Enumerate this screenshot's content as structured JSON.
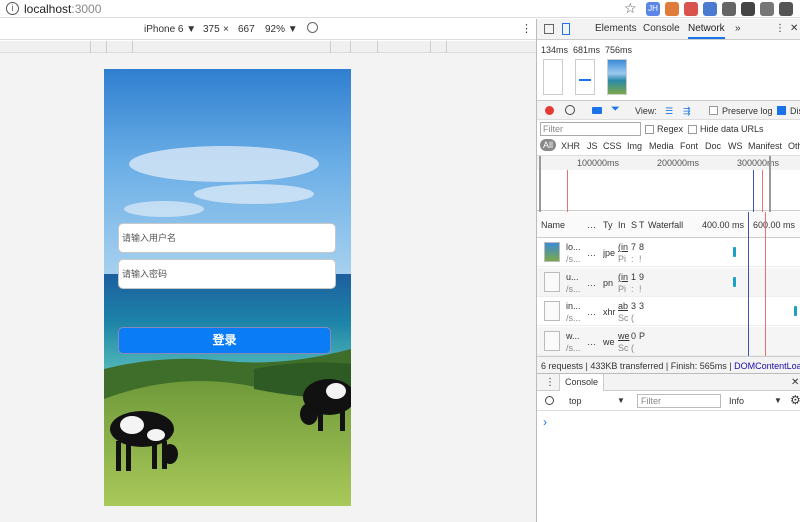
{
  "browser": {
    "url_host": "localhost",
    "url_port": ":3000",
    "extensions": [
      {
        "label": "JH",
        "color": "#5b86e5"
      },
      {
        "label": "",
        "color": "#e07b39"
      },
      {
        "label": "",
        "color": "#d9534f"
      },
      {
        "label": "",
        "color": "#4a7bd0"
      },
      {
        "label": "",
        "color": "#666666"
      },
      {
        "label": "",
        "color": "#444444"
      },
      {
        "label": "",
        "color": "#777777"
      },
      {
        "label": "",
        "color": "#555555"
      }
    ]
  },
  "device_toolbar": {
    "device": "iPhone 6 ▼",
    "width": "375",
    "times": "×",
    "height": "667",
    "zoom": "92% ▼"
  },
  "phone": {
    "username_placeholder": "请输入用户名",
    "password_placeholder": "请输入密码",
    "login_label": "登录"
  },
  "devtools": {
    "tabs": [
      "Elements",
      "Console",
      "Network"
    ],
    "active_tab": "Network",
    "more": "»",
    "screenshot_times": [
      "134ms",
      "681ms",
      "756ms"
    ],
    "view_label": "View:",
    "preserve_log": "Preserve log",
    "disable_cache": "Dis",
    "filter_placeholder": "Filter",
    "regex": "Regex",
    "hide_data_urls": "Hide data URLs",
    "type_filters": [
      "All",
      "XHR",
      "JS",
      "CSS",
      "Img",
      "Media",
      "Font",
      "Doc",
      "WS",
      "Manifest",
      "Oth"
    ],
    "overview_ticks": [
      "100000ms",
      "200000ms",
      "300000ms"
    ],
    "columns": {
      "name": "Name",
      "dots": "…",
      "type": "Ty",
      "initiator": "In",
      "size": "S",
      "time": "T",
      "waterfall": "Waterfall",
      "wf_t1": "400.00 ms",
      "wf_t2": "600.00 ms"
    },
    "requests": [
      {
        "name": "lo...",
        "path": "/s...",
        "dots": "…",
        "type": "jpe",
        "init": "(in",
        "init2": "Pi",
        "size": "7",
        "size2": ":",
        "time": "8",
        "time2": "!"
      },
      {
        "name": "u...",
        "path": "/s...",
        "dots": "…",
        "type": "pn",
        "init": "(in",
        "init2": "Pi",
        "size": "1",
        "size2": ":",
        "time": "9",
        "time2": "!"
      },
      {
        "name": "in...",
        "path": "/s...",
        "dots": "…",
        "type": "xhr",
        "init": "ab",
        "init2": "Sc",
        "size": "3",
        "size2": "(",
        "time": "3",
        "time2": ""
      },
      {
        "name": "w...",
        "path": "/s...",
        "dots": "…",
        "type": "we",
        "init": "we",
        "init2": "Sc",
        "size": "0",
        "size2": "(",
        "time": "P",
        "time2": ""
      }
    ],
    "summary": "6 requests | 433KB transferred | Finish: 565ms | ",
    "summary_link": "DOMContentLoad...",
    "console_tab": "Console",
    "context": "top",
    "console_filter": "Filter",
    "level": "Info",
    "prompt": "›"
  }
}
